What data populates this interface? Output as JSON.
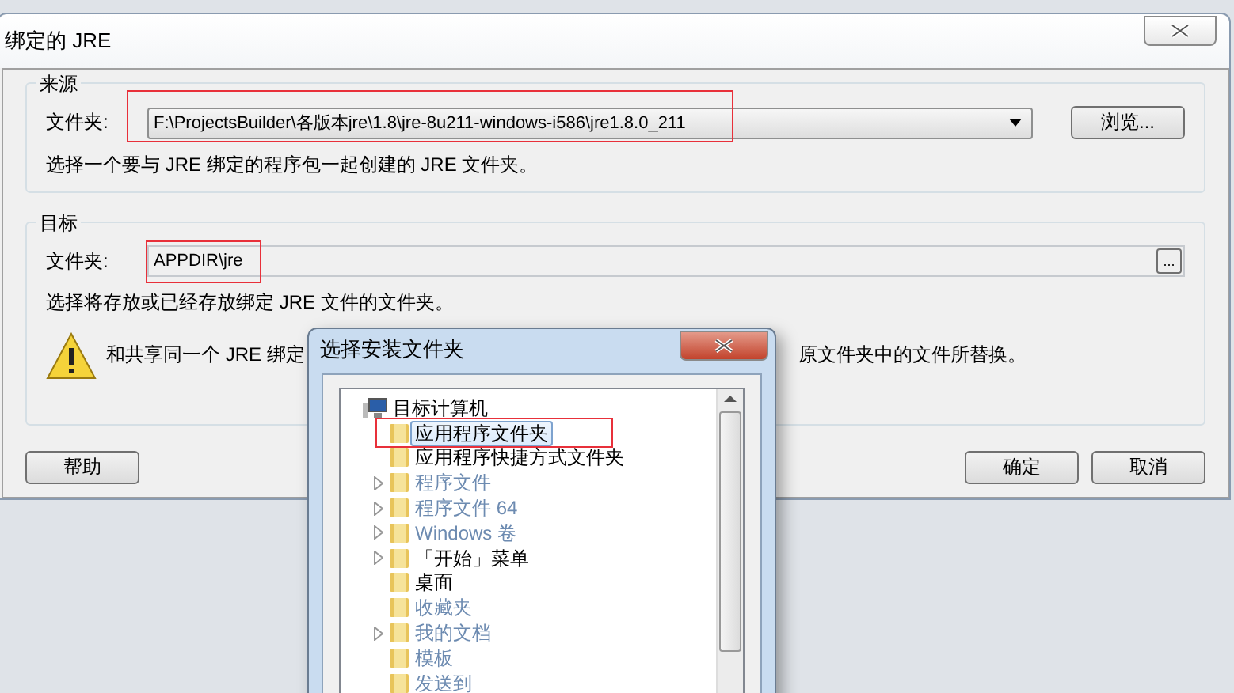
{
  "dialog": {
    "title": "绑定的 JRE"
  },
  "source_group": {
    "title": "来源",
    "label": "文件夹:",
    "value": "F:\\ProjectsBuilder\\各版本jre\\1.8\\jre-8u211-windows-i586\\jre1.8.0_211",
    "highlighted": true,
    "browse_button": "浏览...",
    "hint": "选择一个要与 JRE 绑定的程序包一起创建的 JRE 文件夹。"
  },
  "target_group": {
    "title": "目标",
    "label": "文件夹:",
    "value": "APPDIR\\jre",
    "highlighted": true,
    "ellipsis_button": "...",
    "hint": "选择将存放或已经存放绑定 JRE 文件的文件夹。",
    "warning_left": "和共享同一个 JRE 绑定",
    "warning_right": "原文件夹中的文件所替换。"
  },
  "buttons": {
    "help": "帮助",
    "ok": "确定",
    "cancel": "取消"
  },
  "folder_dialog": {
    "title": "选择安装文件夹",
    "tree": [
      {
        "label": "目标计算机",
        "kind": "computer",
        "expanded": true,
        "disabled": false,
        "selected": false,
        "highlighted": false,
        "children": [
          {
            "label": "应用程序文件夹",
            "kind": "folder",
            "expandable": false,
            "disabled": false,
            "selected": true,
            "highlighted": true
          },
          {
            "label": "应用程序快捷方式文件夹",
            "kind": "folder",
            "expandable": false,
            "disabled": false,
            "selected": false,
            "highlighted": false
          },
          {
            "label": "程序文件",
            "kind": "folder",
            "expandable": true,
            "disabled": true,
            "selected": false,
            "highlighted": false
          },
          {
            "label": "程序文件 64",
            "kind": "folder",
            "expandable": true,
            "disabled": true,
            "selected": false,
            "highlighted": false
          },
          {
            "label": "Windows 卷",
            "kind": "folder",
            "expandable": true,
            "disabled": true,
            "selected": false,
            "highlighted": false
          },
          {
            "label": "「开始」菜单",
            "kind": "folder",
            "expandable": true,
            "disabled": false,
            "selected": false,
            "highlighted": false
          },
          {
            "label": "桌面",
            "kind": "folder",
            "expandable": false,
            "disabled": false,
            "selected": false,
            "highlighted": false
          },
          {
            "label": "收藏夹",
            "kind": "folder",
            "expandable": false,
            "disabled": true,
            "selected": false,
            "highlighted": false
          },
          {
            "label": "我的文档",
            "kind": "folder",
            "expandable": true,
            "disabled": true,
            "selected": false,
            "highlighted": false
          },
          {
            "label": "模板",
            "kind": "folder",
            "expandable": false,
            "disabled": true,
            "selected": false,
            "highlighted": false
          },
          {
            "label": "发送到",
            "kind": "folder",
            "expandable": false,
            "disabled": true,
            "selected": false,
            "highlighted": false
          }
        ]
      }
    ]
  }
}
